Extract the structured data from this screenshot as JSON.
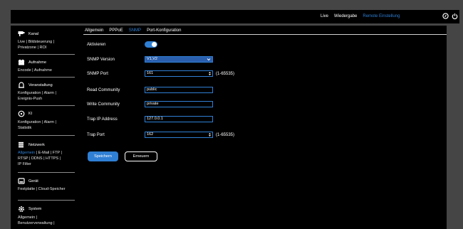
{
  "topnav": {
    "live": "Live",
    "playback": "Wiedergabe",
    "remote": "Remote Einstellung"
  },
  "colors": {
    "accent": "#2f7fd4",
    "background": "#000000",
    "frame": "#454545"
  },
  "sidebar": {
    "sections": [
      {
        "title": "Kanal",
        "icon": "camera-icon",
        "links": [
          "Live | Bildsteuerung |",
          "Privatzone | ROI"
        ]
      },
      {
        "title": "Aufnahme",
        "icon": "record-icon",
        "links": [
          "Encode | Aufnahme"
        ]
      },
      {
        "title": "Veranstaltung",
        "icon": "alarm-icon",
        "links": [
          "Konfiguration | Alarm |",
          "Ereignis-Push"
        ]
      },
      {
        "title": "KI",
        "icon": "ai-icon",
        "links": [
          "Konfiguration | Alarm |",
          "Statistik"
        ]
      },
      {
        "title": "Netzwerk",
        "icon": "network-icon",
        "links_highlight": "Allgemein",
        "links_rest": " | E-Mail | FTP |",
        "links": [
          "RTSP | DDNS | HTTPS |",
          "IP Filter"
        ]
      },
      {
        "title": "Gerät",
        "icon": "hdd-icon",
        "links": [
          "Festplatte | Cloud-Speicher"
        ]
      },
      {
        "title": "System",
        "icon": "gear-icon",
        "links": [
          "Allgemein |",
          "Benutzerverwaltung |"
        ]
      }
    ]
  },
  "tabs": [
    "Allgemein",
    "PPPoE",
    "SNMP",
    "Port-Konfiguration"
  ],
  "active_tab": "SNMP",
  "form": {
    "enable_label": "Aktivieren",
    "enabled": true,
    "version_label": "SNMP Version",
    "version_value": "V1,V2",
    "port_label": "SNMP Port",
    "port_value": "161",
    "port_hint": "(1-65535)",
    "read_label": "Read Community",
    "read_value": "public",
    "write_label": "Write Community",
    "write_value": "private",
    "trap_ip_label": "Trap IP Address",
    "trap_ip_value": "127.0.0.1",
    "trap_port_label": "Trap Port",
    "trap_port_value": "162",
    "trap_port_hint": "(1-65535)"
  },
  "buttons": {
    "save": "Speichern",
    "renew": "Erneuern"
  }
}
